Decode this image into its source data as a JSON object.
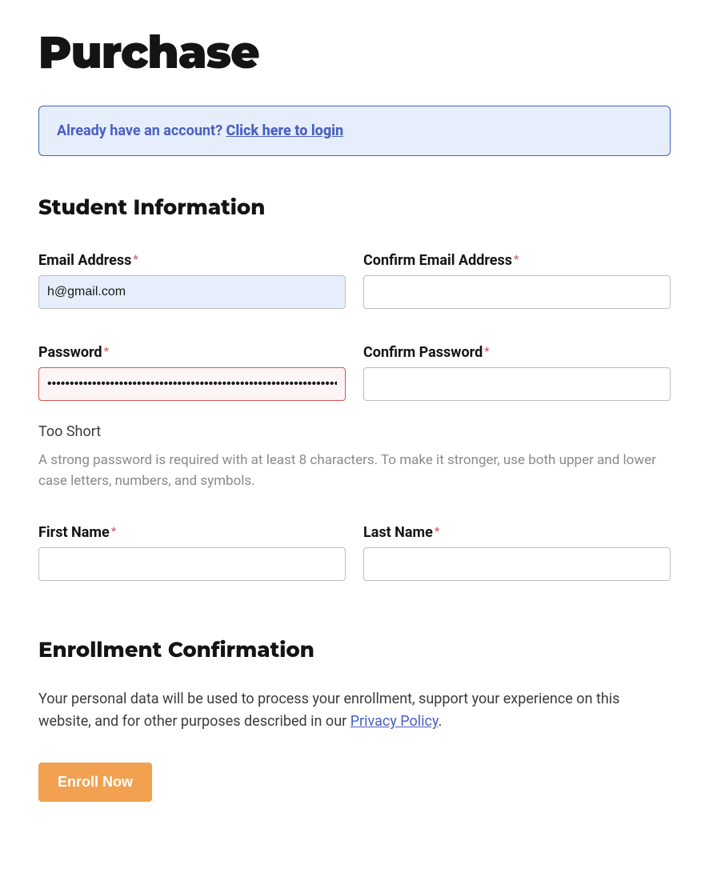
{
  "page": {
    "title": "Purchase"
  },
  "notice": {
    "text": "Already have an account? ",
    "link_text": "Click here to login"
  },
  "student_info": {
    "heading": "Student Information",
    "email": {
      "label": "Email Address",
      "value": "h@gmail.com"
    },
    "confirm_email": {
      "label": "Confirm Email Address",
      "value": ""
    },
    "password": {
      "label": "Password",
      "value": "••••••••••••••••••••••••••••••••••••••••••••••••••••••••••••••••••••••••",
      "strength": "Too Short",
      "help": "A strong password is required with at least 8 characters. To make it stronger, use both upper and lower case letters, numbers, and symbols."
    },
    "confirm_password": {
      "label": "Confirm Password",
      "value": ""
    },
    "first_name": {
      "label": "First Name",
      "value": ""
    },
    "last_name": {
      "label": "Last Name",
      "value": ""
    }
  },
  "enrollment": {
    "heading": "Enrollment Confirmation",
    "text_before": "Your personal data will be used to process your enrollment, support your experience on this website, and for other purposes described in our ",
    "link_text": "Privacy Policy",
    "text_after": ".",
    "button": "Enroll Now"
  }
}
